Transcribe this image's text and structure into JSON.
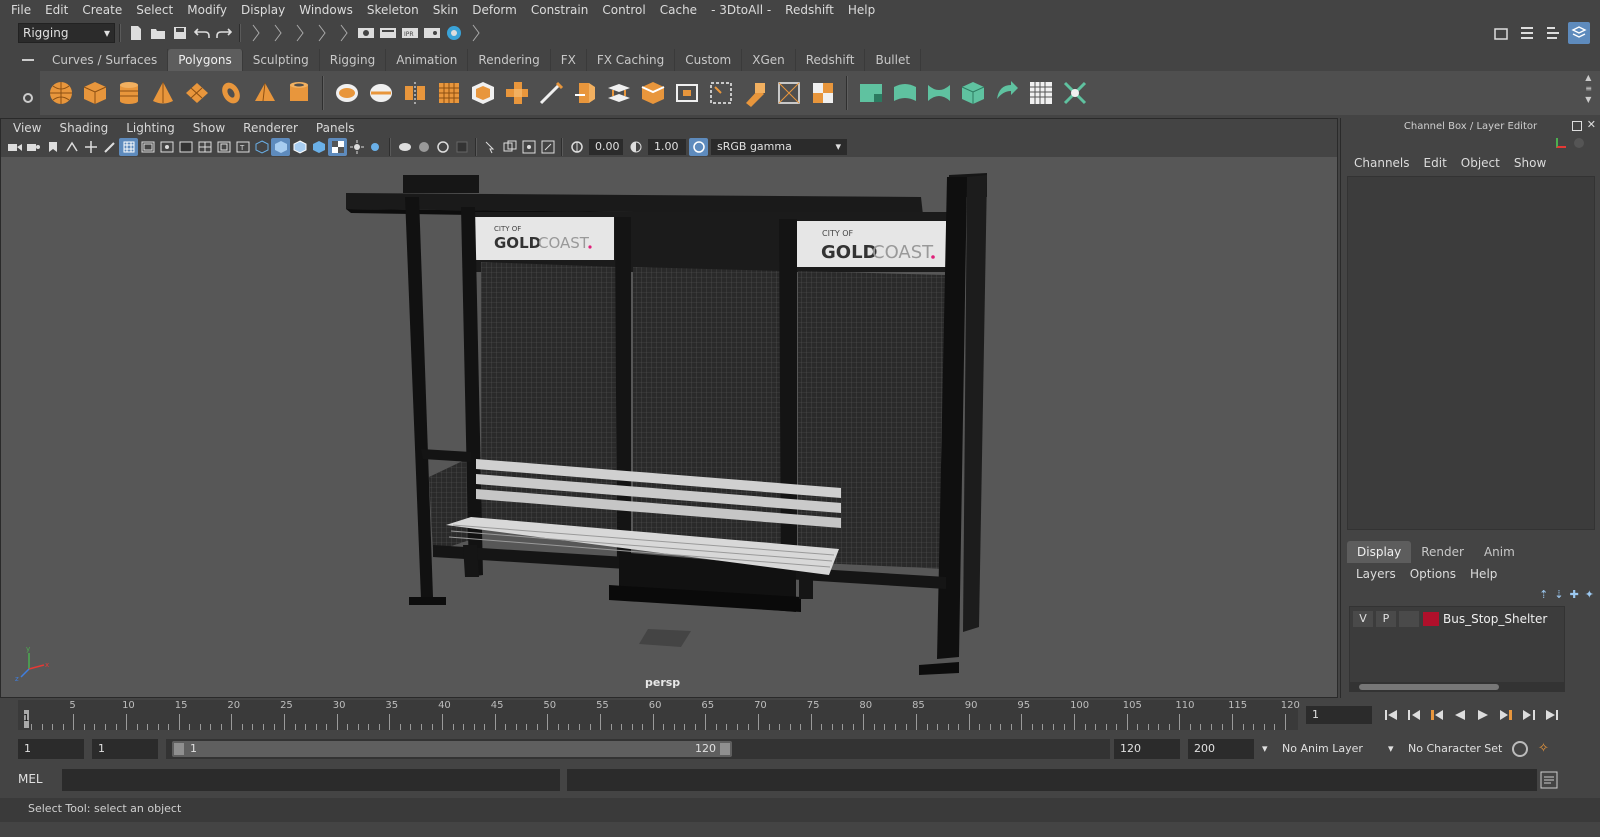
{
  "menubar": {
    "items": [
      "File",
      "Edit",
      "Create",
      "Select",
      "Modify",
      "Display",
      "Windows",
      "Skeleton",
      "Skin",
      "Deform",
      "Constrain",
      "Control",
      "Cache",
      "- 3DtoAll -",
      "Redshift",
      "Help"
    ]
  },
  "statusline": {
    "mode": "Rigging"
  },
  "shelf": {
    "tabs": [
      "Curves / Surfaces",
      "Polygons",
      "Sculpting",
      "Rigging",
      "Animation",
      "Rendering",
      "FX",
      "FX Caching",
      "Custom",
      "XGen",
      "Redshift",
      "Bullet"
    ],
    "active_tab": "Polygons"
  },
  "viewport": {
    "menu": [
      "View",
      "Shading",
      "Lighting",
      "Show",
      "Renderer",
      "Panels"
    ],
    "exposure": "0.00",
    "gamma": "1.00",
    "color_space": "sRGB gamma",
    "camera_label": "persp",
    "sign_line1": "CITY OF",
    "sign_gold": "GOLD",
    "sign_coast": "COAST",
    "colors": {
      "background": "#575757",
      "accent_pink": "#e0207a"
    }
  },
  "right_panel": {
    "title": "Channel Box / Layer Editor",
    "menu": [
      "Channels",
      "Edit",
      "Object",
      "Show"
    ],
    "tabs": [
      "Display",
      "Render",
      "Anim"
    ],
    "active_tab": "Display",
    "layer_menu": [
      "Layers",
      "Options",
      "Help"
    ],
    "layer": {
      "visible": "V",
      "playback": "P",
      "name": "Bus_Stop_Shelter",
      "color": "#b0102b"
    }
  },
  "timeline": {
    "ticks": [
      "5",
      "10",
      "15",
      "20",
      "25",
      "30",
      "35",
      "40",
      "45",
      "50",
      "55",
      "60",
      "65",
      "70",
      "75",
      "80",
      "85",
      "90",
      "95",
      "100",
      "105",
      "110",
      "115",
      "120"
    ],
    "current_frame": "1",
    "current_frame_field": "1"
  },
  "range": {
    "start_field": "1",
    "playback_start": "1",
    "range_start_label": "1",
    "range_end_label": "120",
    "playback_end": "120",
    "end_field": "200",
    "anim_layer": "No Anim Layer",
    "character_set": "No Character Set"
  },
  "cmdline": {
    "label": "MEL"
  },
  "helpline": {
    "text": "Select Tool: select an object"
  }
}
